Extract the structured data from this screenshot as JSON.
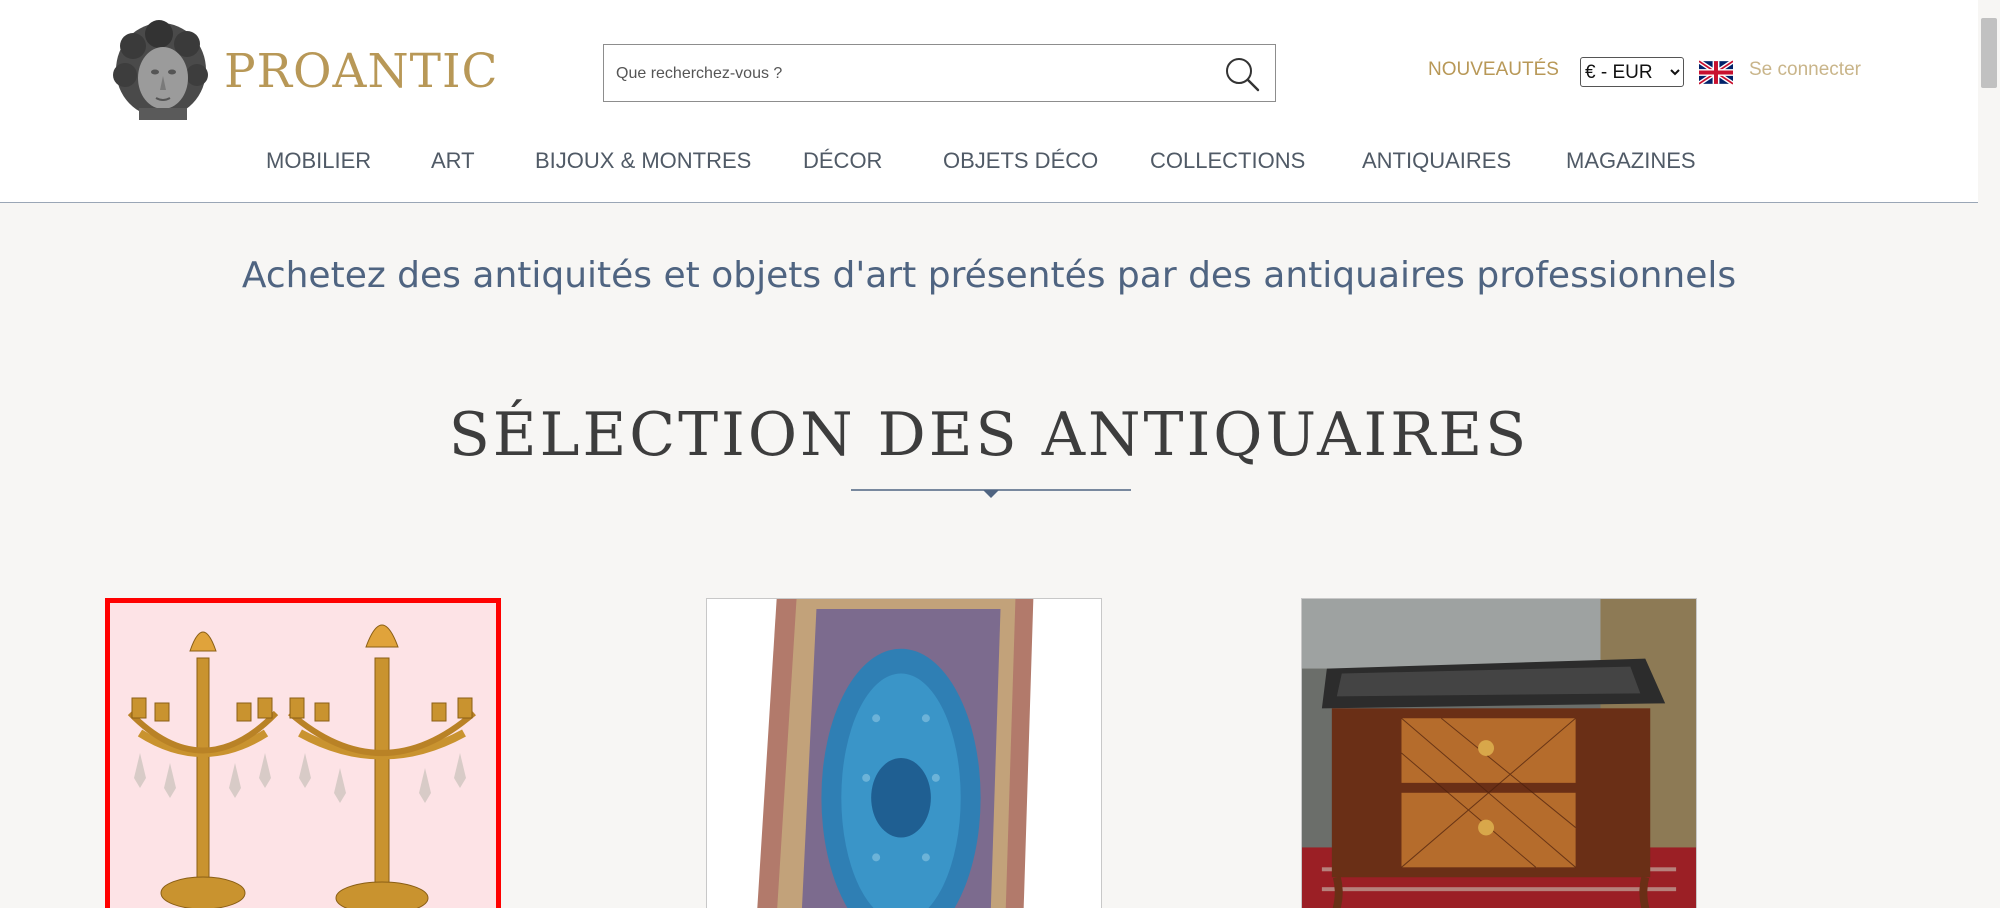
{
  "site": {
    "brand": "PROANTIC",
    "logo_icon": "bust-sculpture-icon"
  },
  "search": {
    "placeholder": "Que recherchez-vous ?",
    "icon": "search-icon"
  },
  "header": {
    "new_label": "NOUVEAUTÉS",
    "currency_selected": "€ - EUR",
    "language_flag": "uk-flag-icon",
    "login_label": "Se connecter"
  },
  "nav": {
    "items": [
      {
        "label": "MOBILIER"
      },
      {
        "label": "ART"
      },
      {
        "label": "BIJOUX & MONTRES"
      },
      {
        "label": "DÉCOR"
      },
      {
        "label": "OBJETS DÉCO"
      },
      {
        "label": "COLLECTIONS"
      },
      {
        "label": "ANTIQUAIRES"
      },
      {
        "label": "MAGAZINES"
      }
    ]
  },
  "main": {
    "tagline": "Achetez des antiquités et objets d'art présentés par des antiquaires professionnels",
    "section_title": "SÉLECTION DES ANTIQUAIRES",
    "products": [
      {
        "image": "gilded-candelabra-pair"
      },
      {
        "image": "blue-silk-rug"
      },
      {
        "image": "marquetry-commode"
      }
    ]
  },
  "colors": {
    "gold": "#b89857",
    "nav_text": "#505a66",
    "tagline": "#4f6481",
    "highlight": "#ff0000"
  }
}
